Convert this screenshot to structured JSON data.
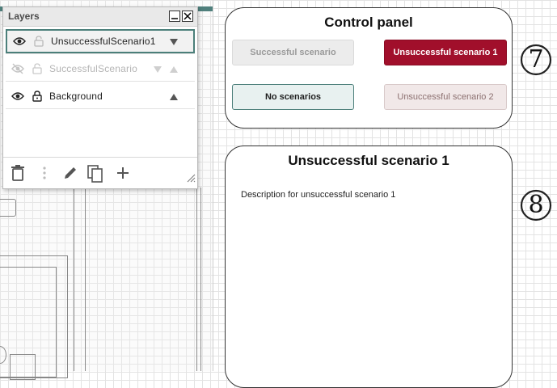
{
  "layers_panel": {
    "title": "Layers",
    "minimize_glyph": "–",
    "close_glyph": "✕",
    "layers": [
      {
        "name": "UnsuccessfulScenario1",
        "visible": true,
        "locked": false,
        "selected": true
      },
      {
        "name": "SuccessfulScenario",
        "visible": false,
        "locked": false,
        "selected": false
      },
      {
        "name": "Background",
        "visible": true,
        "locked": true,
        "selected": false
      }
    ],
    "toolbar_icons": [
      "trash-icon",
      "more-vertical-icon",
      "pencil-icon",
      "duplicate-icon",
      "plus-icon"
    ]
  },
  "control_panel": {
    "title": "Control panel",
    "buttons": [
      {
        "label": "Successful scenario",
        "state": "inactive"
      },
      {
        "label": "Unsuccessful scenario 1",
        "state": "active"
      },
      {
        "label": "No scenarios",
        "state": "outlined"
      },
      {
        "label": "Unsuccessful scenario 2",
        "state": "inactive-pink"
      }
    ]
  },
  "scenario_panel": {
    "title": "Unsuccessful scenario 1",
    "description": "Description for unsuccessful scenario 1"
  },
  "callouts": [
    "7",
    "8"
  ],
  "colors": {
    "accent": "#4b7f7a",
    "active_button": "#a10f2b",
    "inactive_button": "#ececec",
    "outlined_button": "#e8f1f0",
    "pink_button": "#f1e8e8"
  }
}
